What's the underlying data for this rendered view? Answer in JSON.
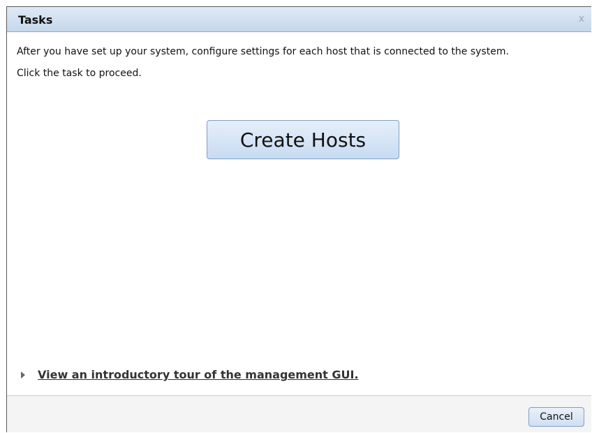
{
  "dialog": {
    "title": "Tasks",
    "close_label": "x"
  },
  "content": {
    "description": "After you have set up your system, configure settings for each host that is connected to the system.",
    "instruction": "Click the task to proceed.",
    "task_button_label": "Create Hosts"
  },
  "tour": {
    "icon": "triangle-right-icon",
    "link_text": "View an introductory tour of the management GUI."
  },
  "footer": {
    "cancel_label": "Cancel"
  },
  "colors": {
    "titlebar": "#c6d7ec",
    "button_fill": "#c8dbf2",
    "button_border": "#7f9fc4",
    "footer_bg": "#f4f4f4"
  }
}
